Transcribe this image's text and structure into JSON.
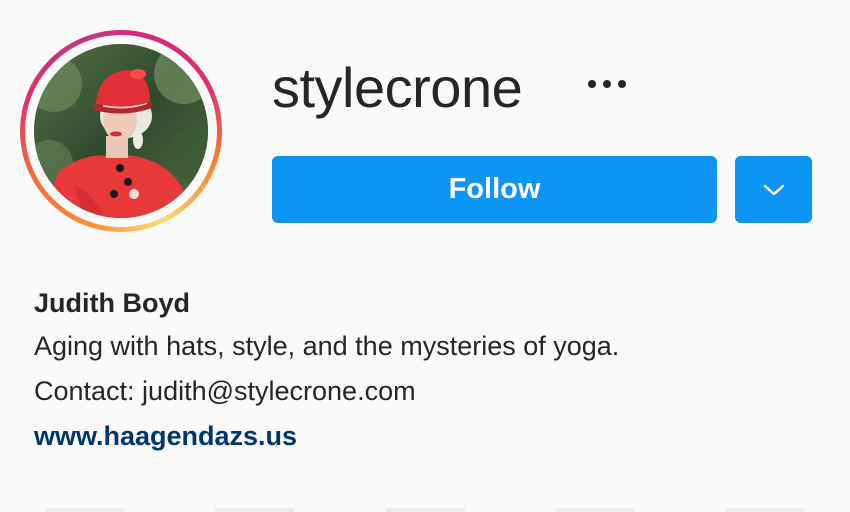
{
  "profile": {
    "username": "stylecrone",
    "full_name": "Judith Boyd",
    "bio_lines": [
      "Aging with hats, style, and the mysteries of yoga.",
      "Contact: judith@stylecrone.com"
    ],
    "website": "www.haagendazs.us"
  },
  "actions": {
    "follow_label": "Follow",
    "more_icon": "more-options-icon",
    "dropdown_icon": "chevron-down-icon"
  },
  "colors": {
    "follow_blue": "#0d95f6",
    "text": "#262626",
    "link": "#00376b",
    "background": "#fafafa"
  }
}
